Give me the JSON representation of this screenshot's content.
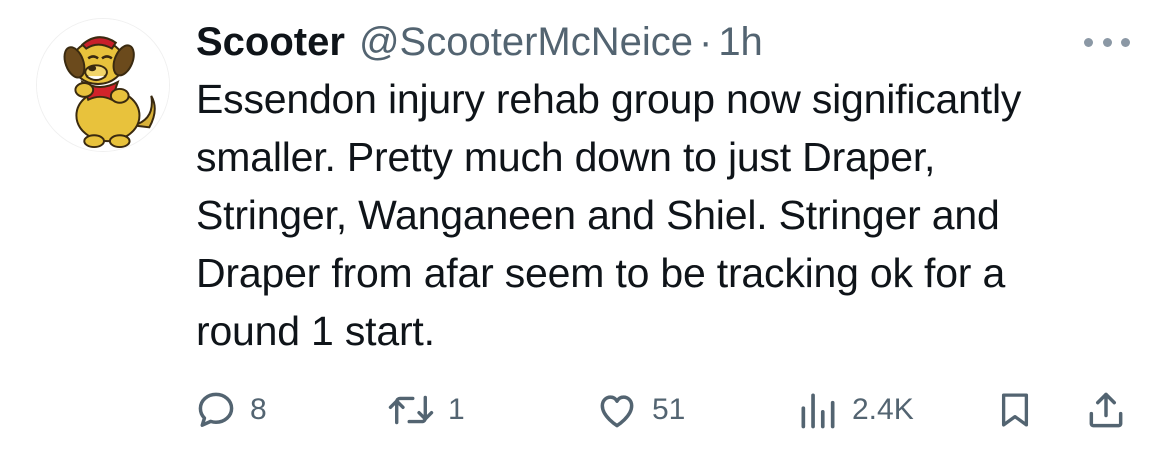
{
  "tweet": {
    "display_name": "Scooter",
    "handle": "@ScooterMcNeice",
    "separator": "·",
    "time": "1h",
    "text_lines": [
      "Essendon injury rehab group now significantly",
      "smaller. Pretty much down to just Draper,",
      "Stringer, Wanganeen and Shiel. Stringer and",
      "Draper from afar seem to be tracking ok for a",
      "round 1 start."
    ]
  },
  "actions": {
    "replies": "8",
    "retweets": "1",
    "likes": "51",
    "views": "2.4K"
  },
  "icons": {
    "reply": "reply-bubble-icon",
    "retweet": "retweet-icon",
    "like": "heart-icon",
    "views": "views-bar-chart-icon",
    "bookmark": "bookmark-icon",
    "share": "share-upload-icon",
    "more": "more-dots-icon"
  },
  "colors": {
    "text": "#0f1419",
    "secondary": "#536471",
    "background": "#ffffff"
  }
}
